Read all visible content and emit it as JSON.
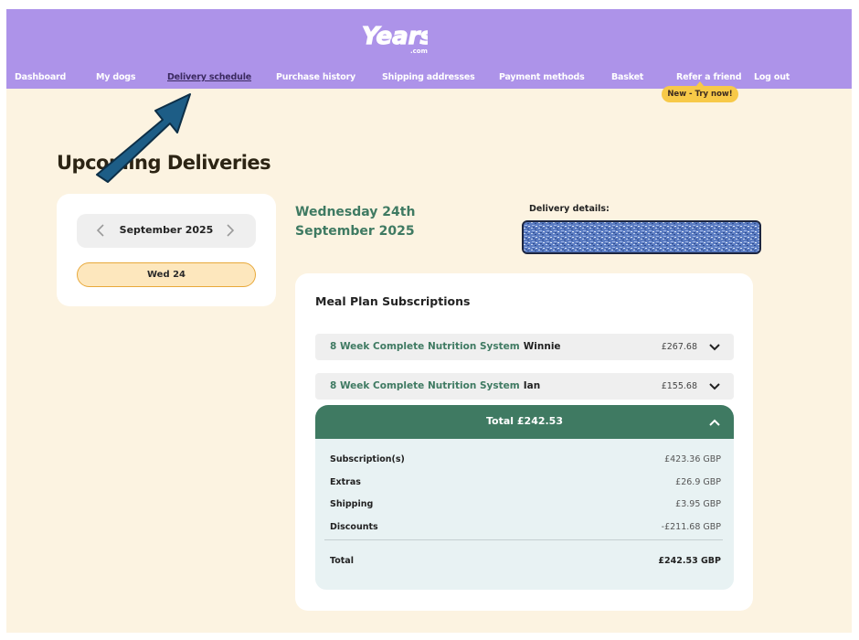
{
  "brand": {
    "logo_text": "Years",
    "logo_sub": ".com"
  },
  "nav": {
    "items": [
      {
        "label": "Dashboard"
      },
      {
        "label": "My dogs"
      },
      {
        "label": "Delivery schedule"
      },
      {
        "label": "Purchase history"
      },
      {
        "label": "Shipping addresses"
      },
      {
        "label": "Payment methods"
      },
      {
        "label": "Basket"
      },
      {
        "label": "Refer a friend"
      },
      {
        "label": "Log out"
      }
    ],
    "active": "Delivery schedule",
    "badge": "New - Try now!"
  },
  "page_title": "Upcoming Deliveries",
  "calendar": {
    "month": "September 2025",
    "selected_day": "Wed 24"
  },
  "delivery": {
    "date_heading": "Wednesday 24th September 2025",
    "details_label": "Delivery details:"
  },
  "subscriptions": {
    "title": "Meal Plan Subscriptions",
    "items": [
      {
        "plan": "8 Week Complete Nutrition System",
        "dog": "Winnie",
        "price": "£267.68"
      },
      {
        "plan": "8 Week Complete Nutrition System",
        "dog": "Ian",
        "price": "£155.68"
      }
    ]
  },
  "totals": {
    "header": "Total £242.53",
    "rows": [
      {
        "label": "Subscription(s)",
        "value": "£423.36 GBP"
      },
      {
        "label": "Extras",
        "value": "£26.9 GBP"
      },
      {
        "label": "Shipping",
        "value": "£3.95 GBP"
      },
      {
        "label": "Discounts",
        "value": "-£211.68 GBP"
      }
    ],
    "total_label": "Total",
    "total_value": "£242.53 GBP"
  },
  "colors": {
    "header_bg": "#ad93e9",
    "page_bg": "#fcf3e1",
    "accent_green": "#3f7a62",
    "badge_yellow": "#f7c948",
    "arrow_blue": "#1d5d86"
  }
}
